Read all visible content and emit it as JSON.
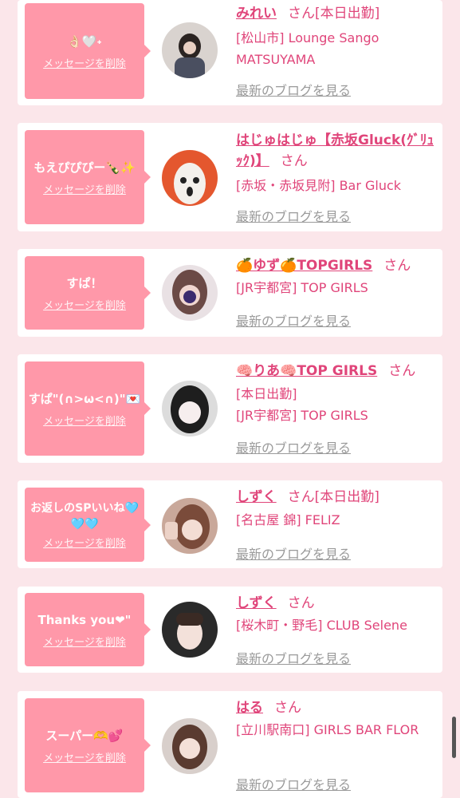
{
  "delete_label": "メッセージを削除",
  "blog_label": "最新のブログを見る",
  "san": "さん",
  "colors": {
    "accent": "#e0457a",
    "bubble": "#ff98a9",
    "background": "#fbe6ea"
  },
  "cards": [
    {
      "message": "👌🏻🤍˖",
      "name": "みれい",
      "status": "[本日出勤]",
      "shop": "[松山市] Lounge Sango MATSUYAMA"
    },
    {
      "message": "もえぴぴぴー🍾✨",
      "name": "はじゅはじゅ【赤坂Gluck(ｸﾞﾘｭｯｸ)】",
      "status": "",
      "shop": "[赤坂・赤坂見附] Bar Gluck"
    },
    {
      "message": "すぱ！",
      "name": "🍊ゆず🍊TOPGIRLS",
      "status": "",
      "shop": "[JR宇都宮] TOP GIRLS"
    },
    {
      "message": "すぱ\"(∩>ω<∩)\"💌",
      "name": "🧠りあ🧠TOP GIRLS",
      "status": "[本日出勤]",
      "shop": "[JR宇都宮] TOP GIRLS"
    },
    {
      "message": "お返しのSPいいね🩵🩵🩵",
      "name": "しずく",
      "status": "[本日出勤]",
      "shop": "[名古屋 錦] FELIZ"
    },
    {
      "message": "Thanks you❤\"",
      "name": "しずく",
      "status": "",
      "shop": "[桜木町・野毛] CLUB Selene"
    },
    {
      "message": "スーパー🫶💕",
      "name": "はる",
      "status": "",
      "shop": "[立川駅南口] GIRLS BAR FLOR"
    }
  ]
}
